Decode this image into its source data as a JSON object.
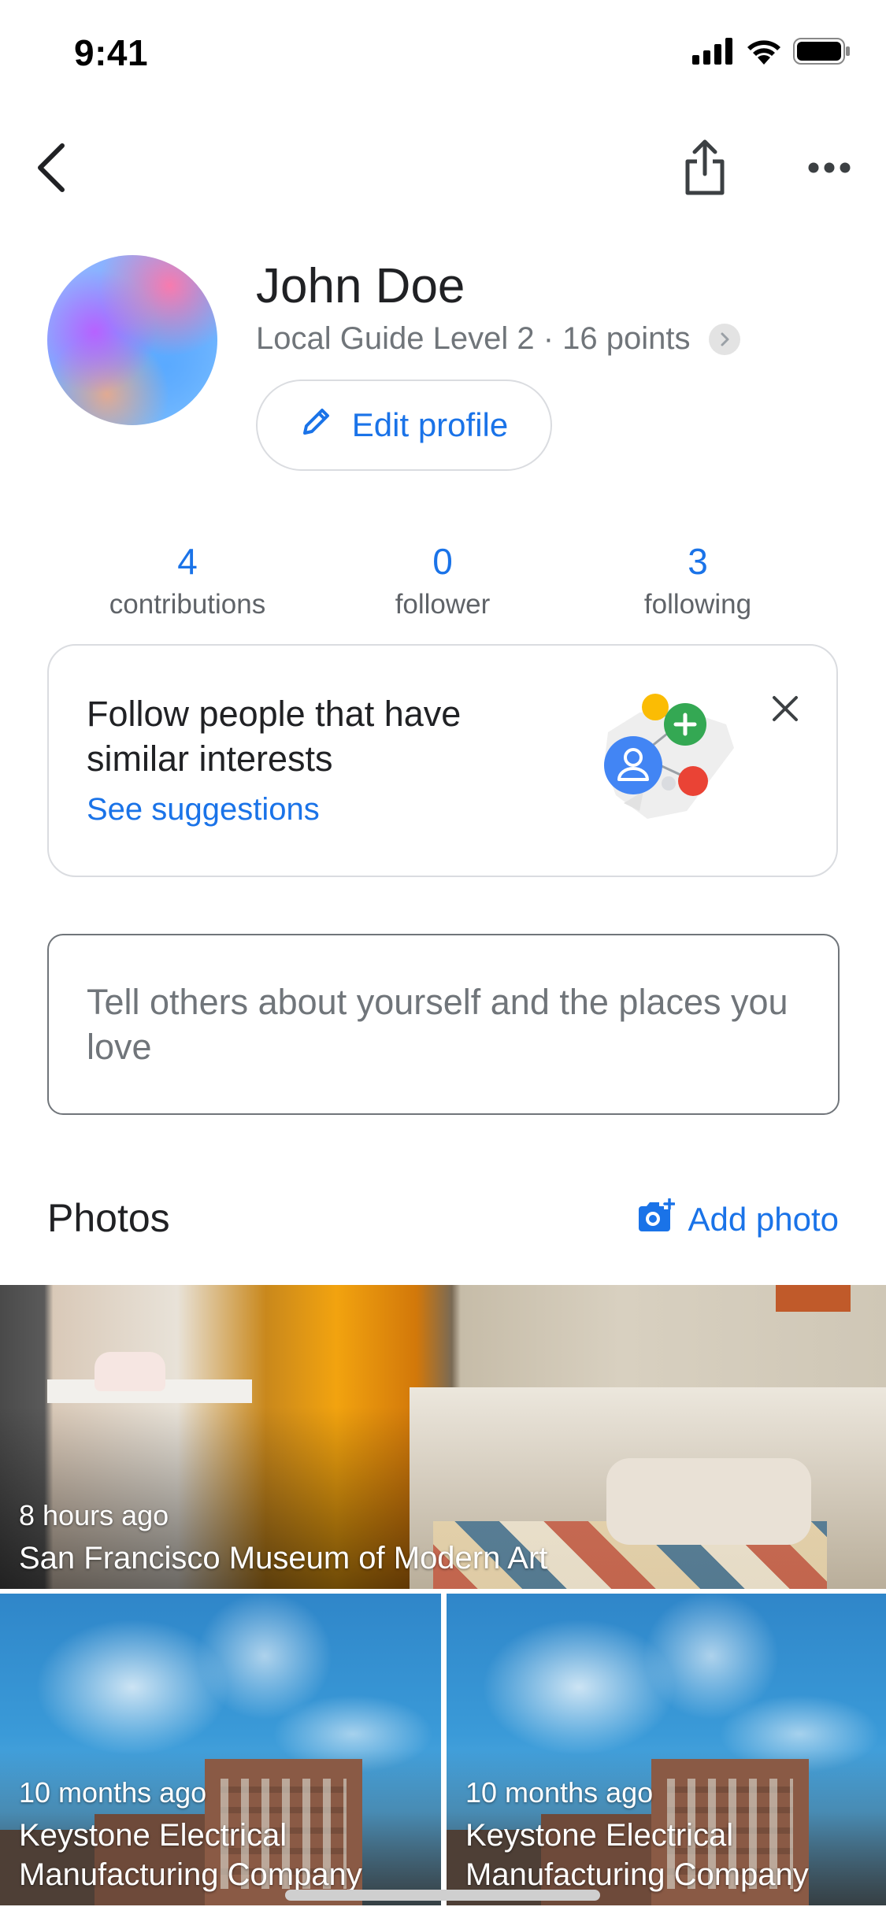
{
  "status_bar": {
    "time": "9:41",
    "icons": [
      "cellular-signal-icon",
      "wifi-icon",
      "battery-icon"
    ]
  },
  "nav": {
    "icons": [
      "chevron-left-icon",
      "share-icon",
      "more-horizontal-icon"
    ]
  },
  "profile": {
    "name": "John Doe",
    "level_text": "Local Guide Level 2 · 16 points",
    "edit_button_label": "Edit profile"
  },
  "stats": [
    {
      "value": "4",
      "label": "contributions"
    },
    {
      "value": "0",
      "label": "follower"
    },
    {
      "value": "3",
      "label": "following"
    }
  ],
  "suggestion_card": {
    "text": "Follow people that have similar interests",
    "link": "See suggestions"
  },
  "bio": {
    "placeholder": "Tell others about yourself and the places you love"
  },
  "photos": {
    "title": "Photos",
    "add_label": "Add photo",
    "items": [
      {
        "time": "8 hours ago",
        "place": "San Francisco Museum of Modern Art"
      },
      {
        "time": "10 months ago",
        "place": "Keystone Electrical Manufacturing Company"
      },
      {
        "time": "10 months ago",
        "place": "Keystone Electrical Manufacturing Company"
      }
    ]
  },
  "colors": {
    "accent": "#1a73e8",
    "text_primary": "#202124",
    "text_secondary": "#70757a",
    "border": "#dadce0"
  }
}
